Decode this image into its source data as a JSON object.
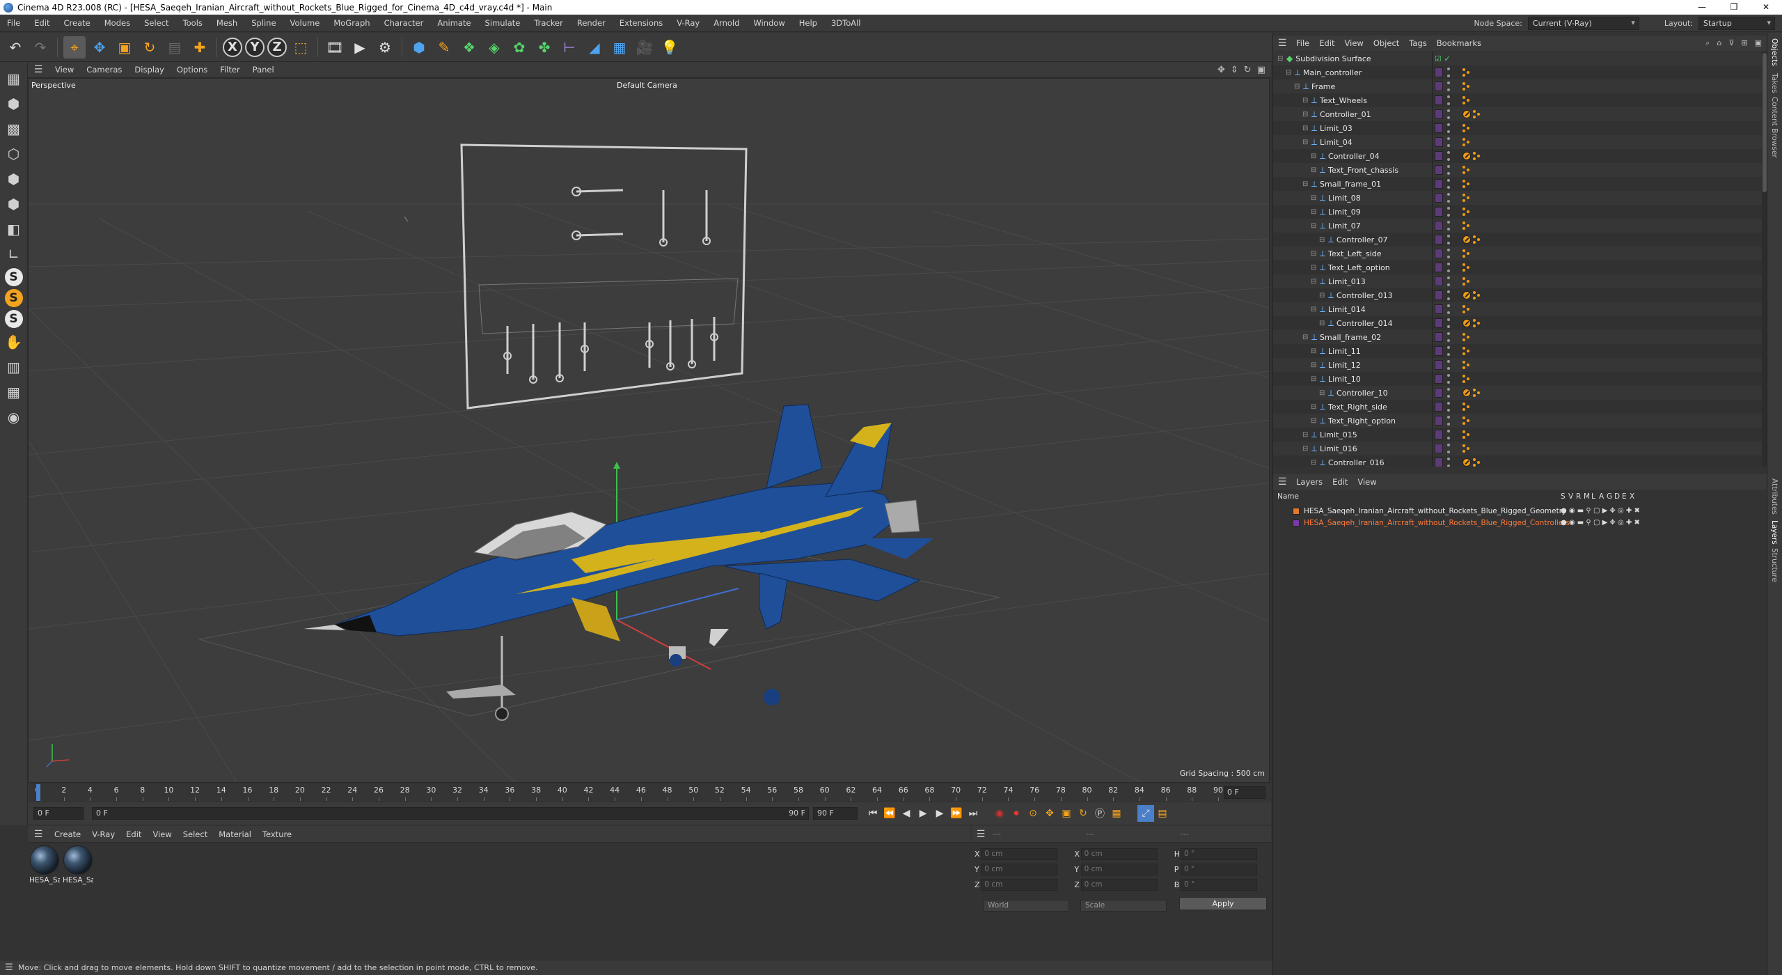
{
  "window": {
    "title": "Cinema 4D R23.008 (RC) - [HESA_Saeqeh_Iranian_Aircraft_without_Rockets_Blue_Rigged_for_Cinema_4D_c4d_vray.c4d *] - Main",
    "minimize": "—",
    "maximize": "❐",
    "close": "✕"
  },
  "menu": {
    "items": [
      "File",
      "Edit",
      "Create",
      "Modes",
      "Select",
      "Tools",
      "Mesh",
      "Spline",
      "Volume",
      "MoGraph",
      "Character",
      "Animate",
      "Simulate",
      "Tracker",
      "Render",
      "Extensions",
      "V-Ray",
      "Arnold",
      "Window",
      "Help",
      "3DToAll"
    ],
    "node_space_label": "Node Space:",
    "node_space_value": "Current (V-Ray)",
    "layout_label": "Layout:",
    "layout_value": "Startup"
  },
  "viewport": {
    "menu": [
      "View",
      "Cameras",
      "Display",
      "Options",
      "Filter",
      "Panel"
    ],
    "projection": "Perspective",
    "camera": "Default Camera",
    "grid_spacing": "Grid Spacing : 500 cm"
  },
  "timeline": {
    "ticks": [
      "0",
      "2",
      "4",
      "6",
      "8",
      "10",
      "12",
      "14",
      "16",
      "18",
      "20",
      "22",
      "24",
      "26",
      "28",
      "30",
      "32",
      "34",
      "36",
      "38",
      "40",
      "42",
      "44",
      "46",
      "48",
      "50",
      "52",
      "54",
      "56",
      "58",
      "60",
      "62",
      "64",
      "66",
      "68",
      "70",
      "72",
      "74",
      "76",
      "78",
      "80",
      "82",
      "84",
      "86",
      "88",
      "90"
    ],
    "current_frame": "0 F",
    "start": "0 F",
    "range_start": "0 F",
    "range_end": "90 F",
    "end": "90 F"
  },
  "materials": {
    "menu": [
      "Create",
      "V-Ray",
      "Edit",
      "View",
      "Select",
      "Material",
      "Texture"
    ],
    "items": [
      {
        "label": "HESA_Sa"
      },
      {
        "label": "HESA_Sa"
      }
    ]
  },
  "coordinates": {
    "header_left": "---",
    "header_mid": "---",
    "header_right": "---",
    "rows": [
      {
        "l1": "X",
        "v1": "0 cm",
        "l2": "X",
        "v2": "0 cm",
        "l3": "H",
        "v3": "0 °"
      },
      {
        "l1": "Y",
        "v1": "0 cm",
        "l2": "Y",
        "v2": "0 cm",
        "l3": "P",
        "v3": "0 °"
      },
      {
        "l1": "Z",
        "v1": "0 cm",
        "l2": "Z",
        "v2": "0 cm",
        "l3": "B",
        "v3": "0 °"
      }
    ],
    "mode": "World",
    "scale": "Scale",
    "apply": "Apply"
  },
  "status": {
    "text": "Move: Click and drag to move elements. Hold down SHIFT to quantize movement / add to the selection in point mode, CTRL to remove."
  },
  "objects": {
    "menu": [
      "File",
      "Edit",
      "View",
      "Object",
      "Tags",
      "Bookmarks"
    ],
    "rows": [
      {
        "name": "Subdivision Surface",
        "level": 0,
        "icon": "subdiv",
        "tag": "none"
      },
      {
        "name": "Main_controller",
        "level": 1,
        "icon": "null",
        "tag": "dots"
      },
      {
        "name": "Frame",
        "level": 2,
        "icon": "null",
        "tag": "dots"
      },
      {
        "name": "Text_Wheels",
        "level": 3,
        "icon": "null",
        "tag": "dots"
      },
      {
        "name": "Controller_01",
        "level": 3,
        "icon": "null",
        "tag": "x"
      },
      {
        "name": "Limit_03",
        "level": 3,
        "icon": "null",
        "tag": "dots"
      },
      {
        "name": "Limit_04",
        "level": 3,
        "icon": "null",
        "tag": "dots"
      },
      {
        "name": "Controller_04",
        "level": 4,
        "icon": "null",
        "tag": "x"
      },
      {
        "name": "Text_Front_chassis",
        "level": 4,
        "icon": "null",
        "tag": "dots"
      },
      {
        "name": "Small_frame_01",
        "level": 3,
        "icon": "null",
        "tag": "dots"
      },
      {
        "name": "Limit_08",
        "level": 4,
        "icon": "null",
        "tag": "dots"
      },
      {
        "name": "Limit_09",
        "level": 4,
        "icon": "null",
        "tag": "dots"
      },
      {
        "name": "Limit_07",
        "level": 4,
        "icon": "null",
        "tag": "dots"
      },
      {
        "name": "Controller_07",
        "level": 5,
        "icon": "null",
        "tag": "x"
      },
      {
        "name": "Text_Left_side",
        "level": 4,
        "icon": "null",
        "tag": "dots"
      },
      {
        "name": "Text_Left_option",
        "level": 4,
        "icon": "null",
        "tag": "dots"
      },
      {
        "name": "Limit_013",
        "level": 4,
        "icon": "null",
        "tag": "dots"
      },
      {
        "name": "Controller_013",
        "level": 5,
        "icon": "null",
        "tag": "x"
      },
      {
        "name": "Limit_014",
        "level": 4,
        "icon": "null",
        "tag": "dots"
      },
      {
        "name": "Controller_014",
        "level": 5,
        "icon": "null",
        "tag": "x"
      },
      {
        "name": "Small_frame_02",
        "level": 3,
        "icon": "null",
        "tag": "dots"
      },
      {
        "name": "Limit_11",
        "level": 4,
        "icon": "null",
        "tag": "dots"
      },
      {
        "name": "Limit_12",
        "level": 4,
        "icon": "null",
        "tag": "dots"
      },
      {
        "name": "Limit_10",
        "level": 4,
        "icon": "null",
        "tag": "dots"
      },
      {
        "name": "Controller_10",
        "level": 5,
        "icon": "null",
        "tag": "x"
      },
      {
        "name": "Text_Right_side",
        "level": 4,
        "icon": "null",
        "tag": "dots"
      },
      {
        "name": "Text_Right_option",
        "level": 4,
        "icon": "null",
        "tag": "dots"
      },
      {
        "name": "Limit_015",
        "level": 3,
        "icon": "null",
        "tag": "dots"
      },
      {
        "name": "Limit_016",
        "level": 3,
        "icon": "null",
        "tag": "dots"
      },
      {
        "name": "Controller_016",
        "level": 4,
        "icon": "null",
        "tag": "x"
      }
    ]
  },
  "layers": {
    "menu": [
      "Layers",
      "Edit",
      "View"
    ],
    "col_name": "Name",
    "col_flags": [
      "S",
      "V",
      "R",
      "M",
      "L",
      "A",
      "G",
      "D",
      "E",
      "X"
    ],
    "rows": [
      {
        "name": "HESA_Saeqeh_Iranian_Aircraft_without_Rockets_Blue_Rigged_Geometry",
        "color": "#e07a2e",
        "text_color": "#e8e8e8"
      },
      {
        "name": "HESA_Saeqeh_Iranian_Aircraft_without_Rockets_Blue_Rigged_Controllers",
        "color": "#7b3aa8",
        "text_color": "#ff7a3d"
      }
    ]
  },
  "side_tabs": [
    "Objects",
    "Takes",
    "Content Browser",
    "Attributes",
    "Layers",
    "Structure"
  ]
}
